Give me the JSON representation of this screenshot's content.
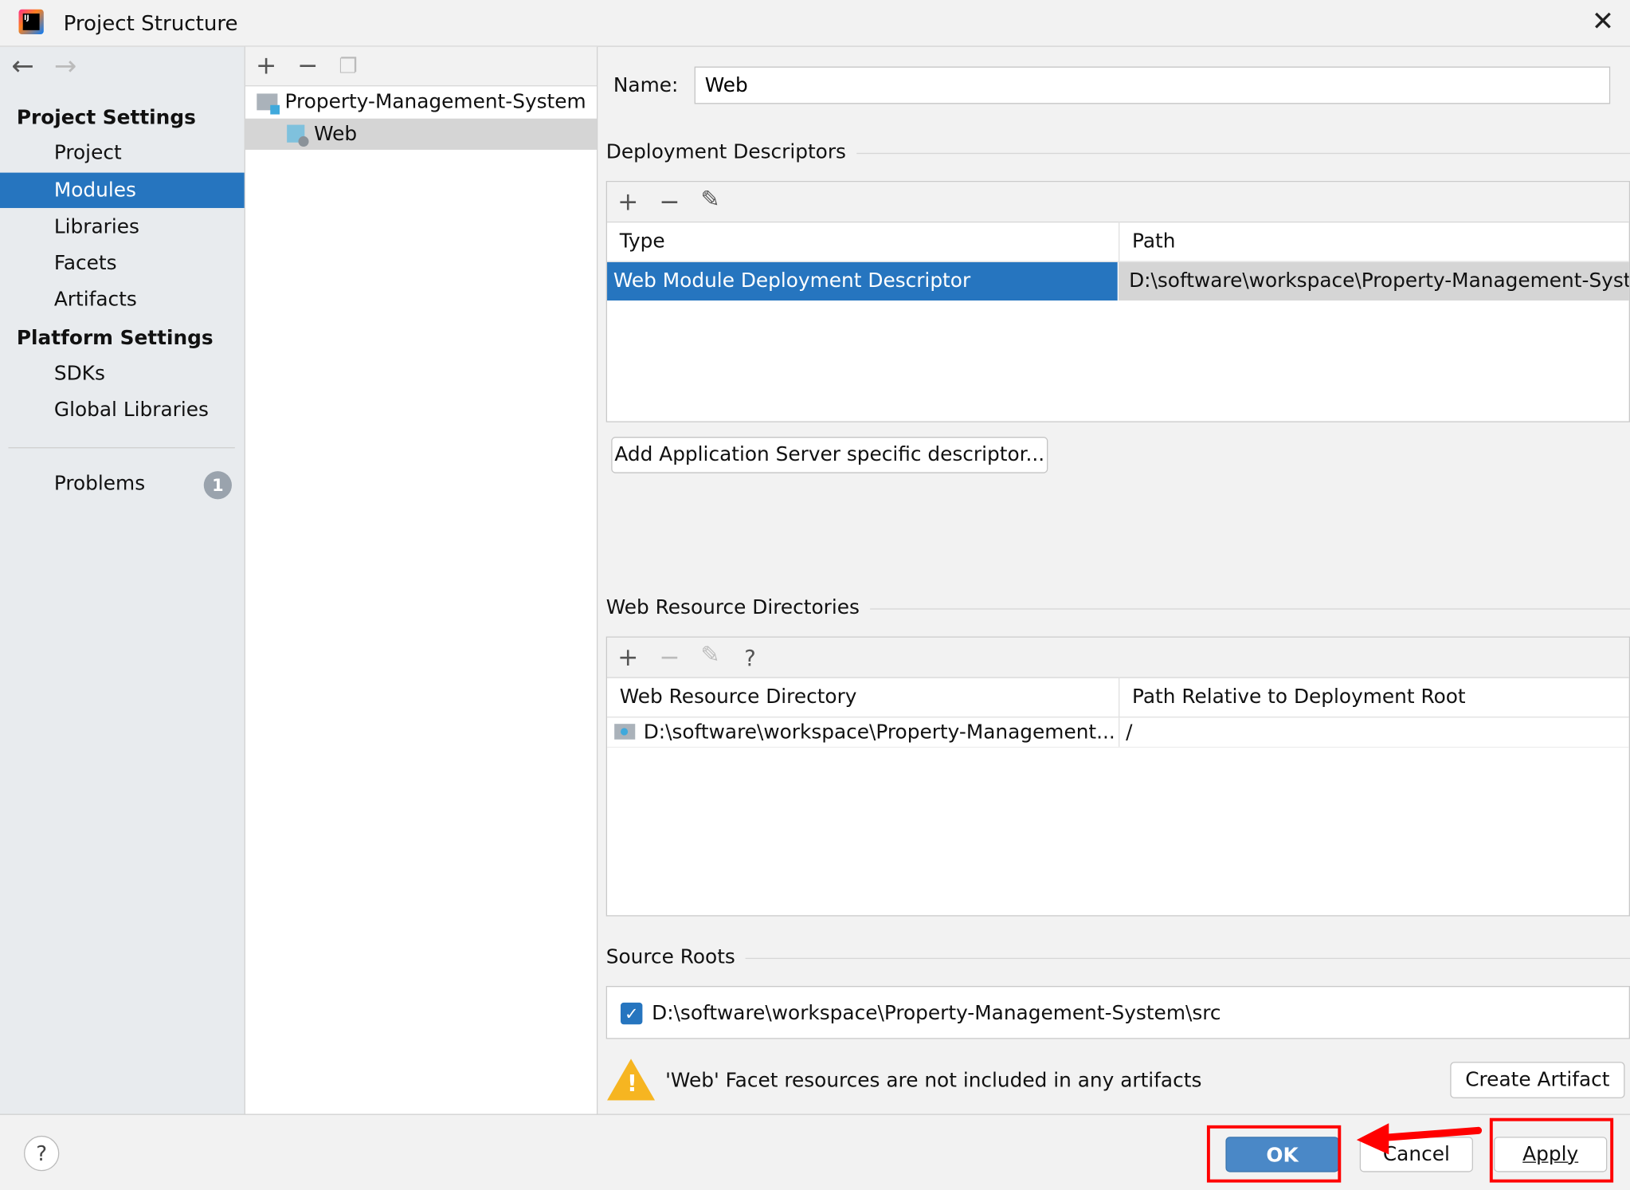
{
  "window": {
    "title": "Project Structure",
    "app_icon": "intellij-idea-icon",
    "close_icon": "close-icon"
  },
  "sidebar": {
    "back_icon": "arrow-left-icon",
    "forward_icon": "arrow-right-icon",
    "project_settings_label": "Project Settings",
    "project_items": [
      {
        "label": "Project"
      },
      {
        "label": "Modules",
        "selected": true
      },
      {
        "label": "Libraries"
      },
      {
        "label": "Facets"
      },
      {
        "label": "Artifacts"
      }
    ],
    "platform_settings_label": "Platform Settings",
    "platform_items": [
      {
        "label": "SDKs"
      },
      {
        "label": "Global Libraries"
      }
    ],
    "problems_label": "Problems",
    "problems_count": "1"
  },
  "tree": {
    "items": [
      {
        "label": "Property-Management-System",
        "icon": "module-folder-icon"
      },
      {
        "label": "Web",
        "icon": "web-facet-icon",
        "selected": true
      }
    ]
  },
  "main": {
    "name_label": "Name:",
    "name_value": "Web",
    "deployment": {
      "title": "Deployment Descriptors",
      "columns": [
        "Type",
        "Path"
      ],
      "rows": [
        {
          "type": "Web Module Deployment Descriptor",
          "path": "D:\\software\\workspace\\Property-Management-System"
        }
      ],
      "add_server_descriptor_label": "Add Application Server specific descriptor..."
    },
    "web_resources": {
      "title": "Web Resource Directories",
      "columns": [
        "Web Resource Directory",
        "Path Relative to Deployment Root"
      ],
      "rows": [
        {
          "dir": "D:\\software\\workspace\\Property-Management...",
          "path": "/"
        }
      ],
      "help": "?"
    },
    "source_roots": {
      "title": "Source Roots",
      "items": [
        {
          "path": "D:\\software\\workspace\\Property-Management-System\\src",
          "checked": true
        }
      ]
    },
    "warning": {
      "text": "'Web' Facet resources are not included in any artifacts",
      "create_artifact_label": "Create Artifact"
    }
  },
  "footer": {
    "help": "?",
    "ok_label": "OK",
    "cancel_label": "Cancel",
    "apply_label": "Apply"
  },
  "colors": {
    "selection": "#2675bf",
    "ok_button": "#4a88c7",
    "annotation": "#ff0000"
  }
}
